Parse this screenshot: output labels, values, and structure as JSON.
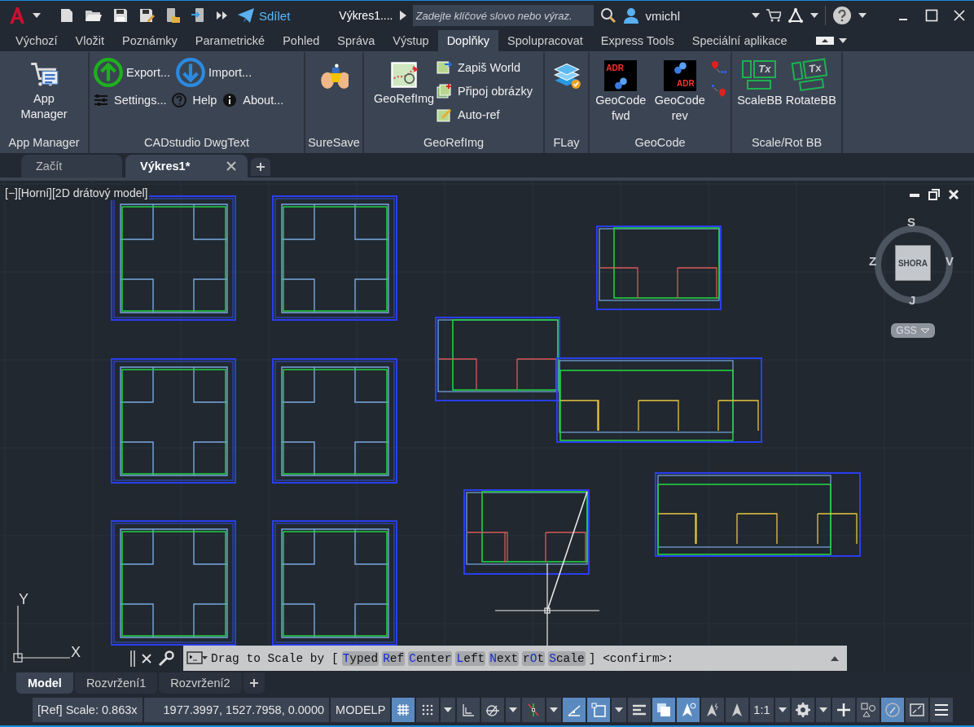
{
  "title_bar": {
    "share_label": "Sdílet",
    "document_title": "Výkres1....",
    "search": {
      "placeholder": "Zadejte klíčové slovo nebo výraz."
    },
    "user_name": "vmichl"
  },
  "ribbon_tabs": [
    {
      "label": "Výchozí",
      "selected": false
    },
    {
      "label": "Vložit",
      "selected": false
    },
    {
      "label": "Poznámky",
      "selected": false
    },
    {
      "label": "Parametrické",
      "selected": false
    },
    {
      "label": "Pohled",
      "selected": false
    },
    {
      "label": "Správa",
      "selected": false
    },
    {
      "label": "Výstup",
      "selected": false
    },
    {
      "label": "Doplňky",
      "selected": true
    },
    {
      "label": "Spolupracovat",
      "selected": false
    },
    {
      "label": "Express Tools",
      "selected": false
    },
    {
      "label": "Speciální aplikace",
      "selected": false
    }
  ],
  "ribbon_panels": [
    {
      "title": "App Manager",
      "kind": "columns",
      "groups": [
        [
          {
            "kind": "large",
            "label": "App Manager"
          }
        ]
      ]
    },
    {
      "title": "CADstudio DwgText",
      "kind": "rows",
      "groups": [
        [
          {
            "kind": "medium",
            "label": "Export..."
          },
          {
            "kind": "medium",
            "label": "Import..."
          }
        ],
        [
          {
            "kind": "small",
            "label": "Settings..."
          },
          {
            "kind": "small",
            "label": "Help"
          },
          {
            "kind": "small",
            "label": "About..."
          }
        ]
      ]
    },
    {
      "title": "SureSave",
      "kind": "columns",
      "groups": [
        [
          {
            "kind": "large"
          }
        ]
      ]
    },
    {
      "title": "GeoRefImg",
      "kind": "columns",
      "groups": [
        [
          {
            "kind": "large",
            "label": "GeoRefImg"
          }
        ],
        [
          {
            "kind": "small",
            "label": "Zapiš World"
          },
          {
            "kind": "small",
            "label": "Připoj obrázky"
          },
          {
            "kind": "small",
            "label": "Auto-ref"
          }
        ]
      ]
    },
    {
      "title": "FLay",
      "kind": "columns",
      "groups": [
        [
          {
            "kind": "large"
          }
        ]
      ]
    },
    {
      "title": "GeoCode",
      "kind": "columns",
      "groups": [
        [
          {
            "kind": "large",
            "label": "GeoCode fwd",
            "icon_text": "ADR"
          }
        ],
        [
          {
            "kind": "large",
            "label": "GeoCode rev",
            "icon_text": "ADR"
          }
        ],
        [
          {
            "kind": "small"
          },
          {
            "kind": "small"
          }
        ]
      ]
    },
    {
      "title": "Scale/Rot BB",
      "kind": "columns",
      "groups": [
        [
          {
            "kind": "large",
            "label": "ScaleBB",
            "icon_text": "Tx"
          }
        ],
        [
          {
            "kind": "large",
            "label": "RotateBB",
            "icon_text": "Tx"
          }
        ]
      ]
    }
  ],
  "document_tabs": [
    {
      "label": "Začít",
      "selected": false,
      "closable": false
    },
    {
      "label": "Výkres1*",
      "selected": true,
      "closable": true
    }
  ],
  "viewport": {
    "label": "[−][Horní][2D drátový model]",
    "viewcube": {
      "face": "SHORA",
      "north": "S",
      "east": "V",
      "south": "J",
      "west": "Z"
    },
    "coordinate_system": "GSS",
    "ucs": {
      "x": "X",
      "y": "Y"
    }
  },
  "command_line": {
    "lead": "Drag to Scale by [",
    "tail": "] <confirm>:",
    "options": [
      {
        "key": "T",
        "after": "yped"
      },
      {
        "key": "R",
        "after": "ef"
      },
      {
        "key": "C",
        "after": "enter"
      },
      {
        "key": "L",
        "after": "eft"
      },
      {
        "key": "N",
        "after": "ext"
      },
      {
        "before": "r",
        "key": "O",
        "after": "t"
      },
      {
        "key": "S",
        "after": "cale"
      }
    ]
  },
  "layout_tabs": [
    {
      "label": "Model",
      "selected": true
    },
    {
      "label": "Rozvržení1",
      "selected": false
    },
    {
      "label": "Rozvržení2",
      "selected": false
    }
  ],
  "status_bar": {
    "prompt": "[Ref] Scale: 0.863x",
    "coordinates": "1977.3997, 1527.7958, 0.0000",
    "space": "MODELP",
    "buttons": [
      {
        "kind": "toggle",
        "on": true
      },
      {
        "kind": "toggle",
        "on": false
      },
      {
        "kind": "caret"
      },
      {
        "kind": "toggle",
        "on": false
      },
      {
        "kind": "toggle",
        "on": false
      },
      {
        "kind": "caret"
      },
      {
        "kind": "toggle",
        "on": false
      },
      {
        "kind": "caret"
      },
      {
        "kind": "toggle",
        "on": true
      },
      {
        "kind": "toggle",
        "on": true
      },
      {
        "kind": "caret"
      },
      {
        "kind": "toggle",
        "on": false
      },
      {
        "kind": "toggle",
        "on": true
      },
      {
        "kind": "toggle",
        "on": true
      },
      {
        "kind": "toggle",
        "on": false
      },
      {
        "kind": "toggle",
        "on": false
      },
      {
        "kind": "text",
        "label": "1:1"
      },
      {
        "kind": "caret"
      },
      {
        "kind": "tool"
      },
      {
        "kind": "caret"
      },
      {
        "kind": "tool"
      },
      {
        "kind": "tool"
      },
      {
        "kind": "toggle",
        "on": true
      },
      {
        "kind": "tool"
      },
      {
        "kind": "tool"
      }
    ]
  }
}
